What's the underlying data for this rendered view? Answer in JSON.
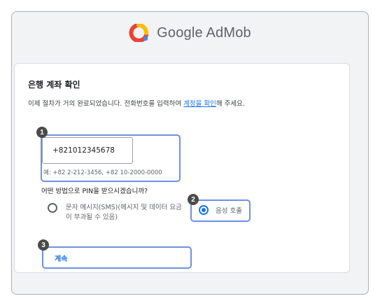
{
  "header": {
    "brand": "Google AdMob",
    "logo_icon": "admob-logo-icon"
  },
  "card": {
    "title": "은행 계좌 확인",
    "desc_before": "이제 절차가 거의 완료되었습니다. 전화번호를 입력하여 ",
    "desc_link": "계정을 확인",
    "desc_after": "해 주세요."
  },
  "phone": {
    "value": "+821012345678",
    "hint": "예: +82 2-212-3456, +82 10-2000-0000"
  },
  "pin_question": "어떤 방법으로 PIN을 받으시겠습니까?",
  "options": {
    "sms": {
      "label": "문자 메시지(SMS)(메시지 및 데이터 요금이 부과될 수 있음)",
      "selected": false
    },
    "voice": {
      "label": "음성 호출",
      "selected": true
    }
  },
  "continue_label": "계속",
  "badges": [
    "1",
    "2",
    "3"
  ],
  "colors": {
    "accent": "#1a73e8",
    "highlight": "#6e8fe3",
    "badge": "#4a4a4a"
  }
}
